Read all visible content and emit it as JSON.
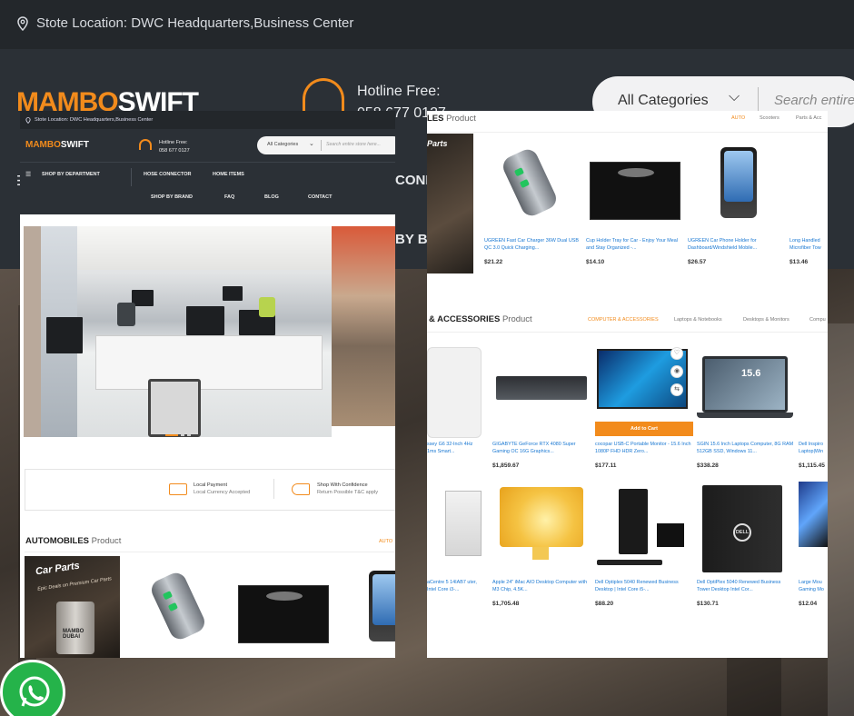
{
  "background": {
    "store_location": "Stote Location: DWC Headquarters,Business Center",
    "logo_part1": "MAMBO",
    "logo_part2": "SWIFT",
    "hotline_label": "Hotline Free:",
    "hotline_number": "058 677 0127",
    "search_category": "All Categories",
    "search_placeholder": "Search entire",
    "nav_connector": "CONNEC",
    "nav_brand": "BY BR"
  },
  "left_page": {
    "store_location": "Stote Location: DWC Headquarters,Business Center",
    "logo_part1": "MAMBO",
    "logo_part2": "SWIFT",
    "hotline_label": "Hotline Free:",
    "hotline_number": "058 677 0127",
    "search_category": "All Categories",
    "search_placeholder": "Search entire store here...",
    "nav": {
      "department": "SHOP BY DEPARTMENT",
      "hose": "HOSE CONNECTOR",
      "home": "HOME ITEMS",
      "brand": "SHOP BY BRAND",
      "faq": "FAQ",
      "blog": "BLOG",
      "contact": "CONTACT"
    },
    "features": [
      {
        "title": "Local Payment",
        "sub": "Local Currency Accepted"
      },
      {
        "title": "Shop With Confidence",
        "sub": "Return Possible T&C apply"
      }
    ],
    "section_bold": "AUTOMOBILES",
    "section_rest": "Product",
    "section_tab": "AUTO",
    "banner_title": "Car Parts",
    "banner_sub": "Epic Deals on Premium Car Parts",
    "banner_can": "MAMBO DUBAI"
  },
  "right_page": {
    "section1_bold": "LES",
    "section1_rest": "Product",
    "section1_tabs": [
      "AUTO",
      "Scooters",
      "Parts & Acc"
    ],
    "banner_text": "Parts",
    "products_row1": [
      {
        "name": "UGREEN Fast Car Charger 36W Dual USB QC 3.0 Quick Charging...",
        "price": "$21.22"
      },
      {
        "name": "Cup Holder Tray for Car - Enjoy Your Meal and Stay Organized -...",
        "price": "$14.10"
      },
      {
        "name": "UGREEN Car Phone Holder for Dashboard/Windshield Mobile...",
        "price": "$26.57"
      },
      {
        "name": "Long Handled Microfiber Tow",
        "price": "$13.46"
      }
    ],
    "section2_bold": "& ACCESSORIES",
    "section2_rest": "Product",
    "section2_tabs": [
      "COMPUTER & ACCESSORIES",
      "Laptops & Notebooks",
      "Desktops & Monitors",
      "Compu"
    ],
    "add_to_cart": "Add to Cart",
    "products_row2": [
      {
        "name": "ssey G6 32-Inch 4Hz 1ms Smart...",
        "price": ""
      },
      {
        "name": "GIGABYTE GeForce RTX 4080 Super Gaming OC 16G Graphics...",
        "price": "$1,859.67"
      },
      {
        "name": "cocopar USB-C Portable Monitor - 15.6 Inch 1080P FHD HDR Zero...",
        "price": "$177.11"
      },
      {
        "name": "SGIN 15.6 Inch Laptops Computer, 8G RAM 512GB SSD, Windows 11...",
        "price": "$338.28"
      },
      {
        "name": "Dell Inspiro Laptop|Win",
        "price": "$1,115.45"
      }
    ],
    "products_row3": [
      {
        "name": "aCentre 5 14IAB7 uter, Intel Core i3-...",
        "price": ""
      },
      {
        "name": "Apple 24\" iMac AIO Desktop Computer with M3 Chip, 4.5K...",
        "price": "$1,705.48"
      },
      {
        "name": "Dell Optiplex 5040 Renewed Business Desktop | Intel Core i5-...",
        "price": "$88.20"
      },
      {
        "name": "Dell OptiPlex 5040 Renewed Business Tower Desktop Intel Cor...",
        "price": "$130.71"
      },
      {
        "name": "Large Mou Gaming Mo",
        "price": "$12.04"
      }
    ],
    "laptop_screen": "15.6",
    "dell_logo": "DELL"
  },
  "colors": {
    "accent": "#f28b1c",
    "dark_header": "#2b3036",
    "link": "#1877d2",
    "whatsapp": "#25b34a"
  }
}
